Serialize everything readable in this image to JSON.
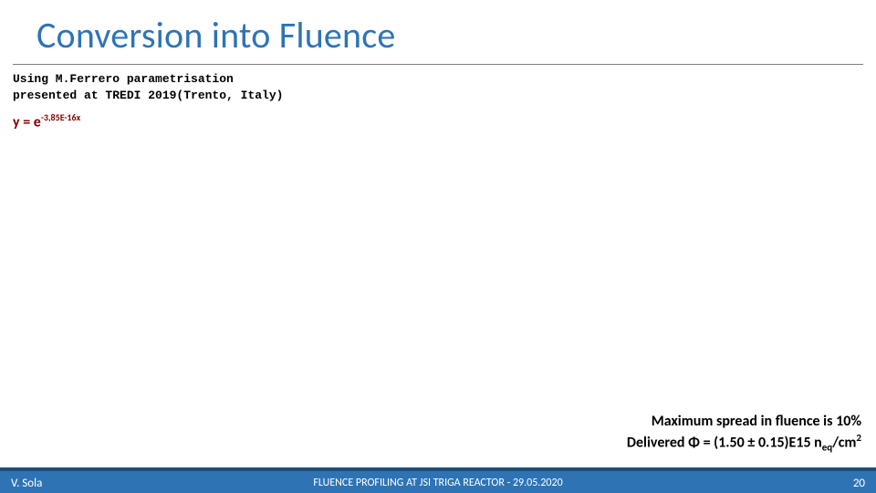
{
  "title": "Conversion into Fluence",
  "param_line1": "Using M.Ferrero parametrisation",
  "param_line2": "presented at TREDI 2019(Trento, Italy)",
  "equation": {
    "prefix": "y = e",
    "exponent": "-3,85E-16x"
  },
  "result": {
    "line1": "Maximum spread in fluence is 10%",
    "line2_prefix": "Delivered Φ = (1.50 ± 0.15)E15 n",
    "line2_sub": "eq",
    "line2_mid": "/cm",
    "line2_sup": "2"
  },
  "footer": {
    "author": "V. Sola",
    "center": "FLUENCE PROFILING AT JSI TRIGA REACTOR -  29.05.2020",
    "page": "20"
  }
}
